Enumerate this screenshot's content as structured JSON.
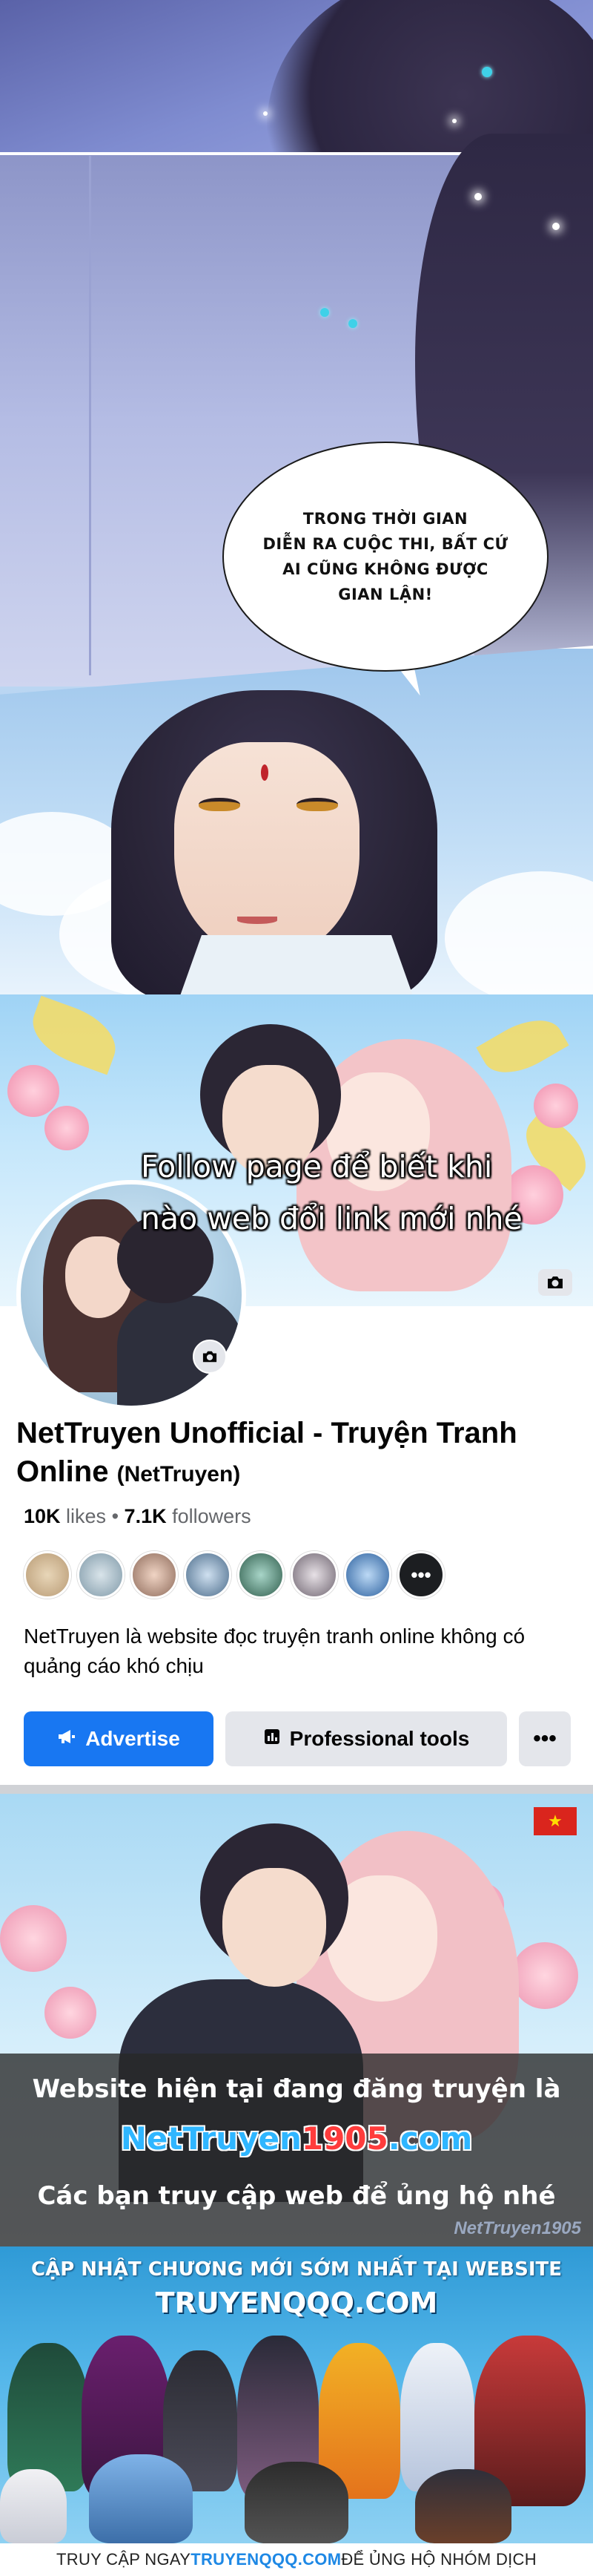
{
  "manga": {
    "speech_bubble": {
      "lines": [
        "TRONG THỜI GIAN",
        "DIỄN RA CUỘC THI, BẤT CỨ",
        "AI CŨNG KHÔNG ĐƯỢC",
        "GIAN LẬN!"
      ]
    }
  },
  "facebook_page": {
    "overlay_line1": "Follow page để biết khi",
    "overlay_line2": "nào web đổi link mới nhé",
    "page_name": "NetTruyen Unofficial - Truyện Tranh Online",
    "page_alias": "(NetTruyen)",
    "likes_count": "10K",
    "likes_label": "likes",
    "stats_separator": "•",
    "followers_count": "7.1K",
    "followers_label": "followers",
    "friends_more": "•••",
    "about": "NetTruyen là website đọc truyện tranh online không có quảng cáo khó chịu",
    "buttons": {
      "advertise": "Advertise",
      "professional_tools": "Professional tools",
      "more": "•••"
    },
    "brand_color": "#1877f2"
  },
  "promo_banner": {
    "line1": "Website hiện tại đang đăng truyện là",
    "site_part1": "NetTruyen",
    "site_part2": "1905",
    "site_part3": ".com",
    "line2": "Các bạn truy cập web để ủng hộ nhé",
    "watermark": "NetTruyen1905"
  },
  "truyenqqq_banner": {
    "header_line1": "CẬP NHẬT CHƯƠNG MỚI SỚM NHẤT TẠI WEBSITE",
    "header_line2": "TRUYENQQQ.COM",
    "footer_prefix": "TRUY CẬP NGAY ",
    "footer_brand": "TRUYENQQQ.COM",
    "footer_suffix": " ĐỂ ỦNG HỘ NHÓM DỊCH"
  }
}
